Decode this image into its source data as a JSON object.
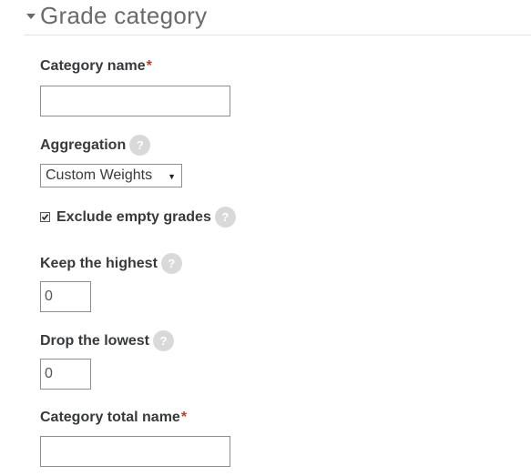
{
  "section": {
    "title": "Grade category",
    "toggle_icon": "caret-down-icon"
  },
  "fields": {
    "category_name": {
      "label": "Category name",
      "required_mark": "*",
      "value": ""
    },
    "aggregation": {
      "label": "Aggregation",
      "selected": "Custom Weights",
      "help_glyph": "?"
    },
    "exclude_empty": {
      "label": "Exclude empty grades",
      "checked": true,
      "help_glyph": "?"
    },
    "keep_highest": {
      "label": "Keep the highest",
      "value": "0",
      "help_glyph": "?"
    },
    "drop_lowest": {
      "label": "Drop the lowest",
      "value": "0",
      "help_glyph": "?"
    },
    "category_total_name": {
      "label": "Category total name",
      "required_mark": "*",
      "value": ""
    }
  },
  "colors": {
    "required": "#c0392b",
    "help_bg": "#d9d9d9"
  }
}
